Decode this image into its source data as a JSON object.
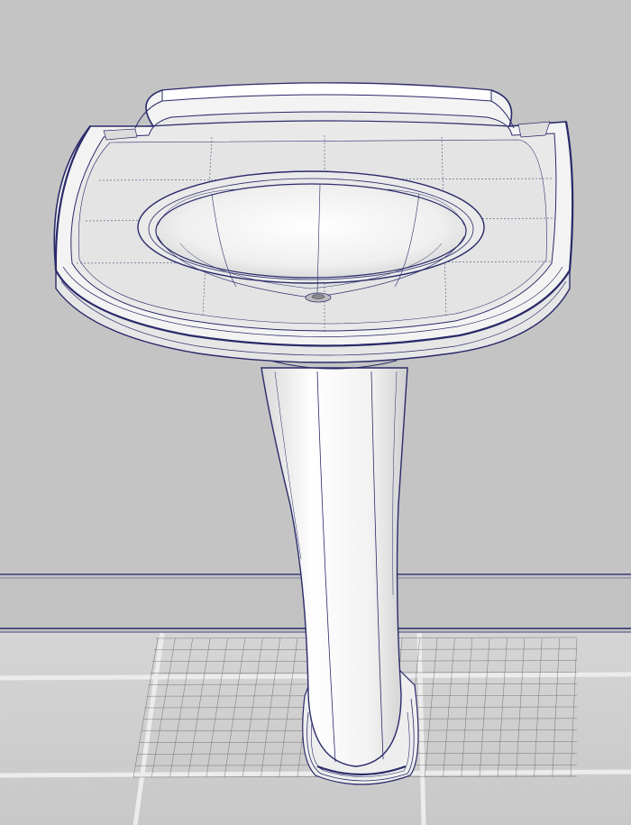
{
  "scene": {
    "subject": "pedestal-sink-wireframe",
    "colors": {
      "wall": "#c4c4c4",
      "floor_tile": "#d6d6d6",
      "floor_grout": "#f2f2f2",
      "wire": "#2a2a6a",
      "porcelain": "#f4f4f4",
      "porcelain_shade": "#dcdcdc"
    }
  }
}
